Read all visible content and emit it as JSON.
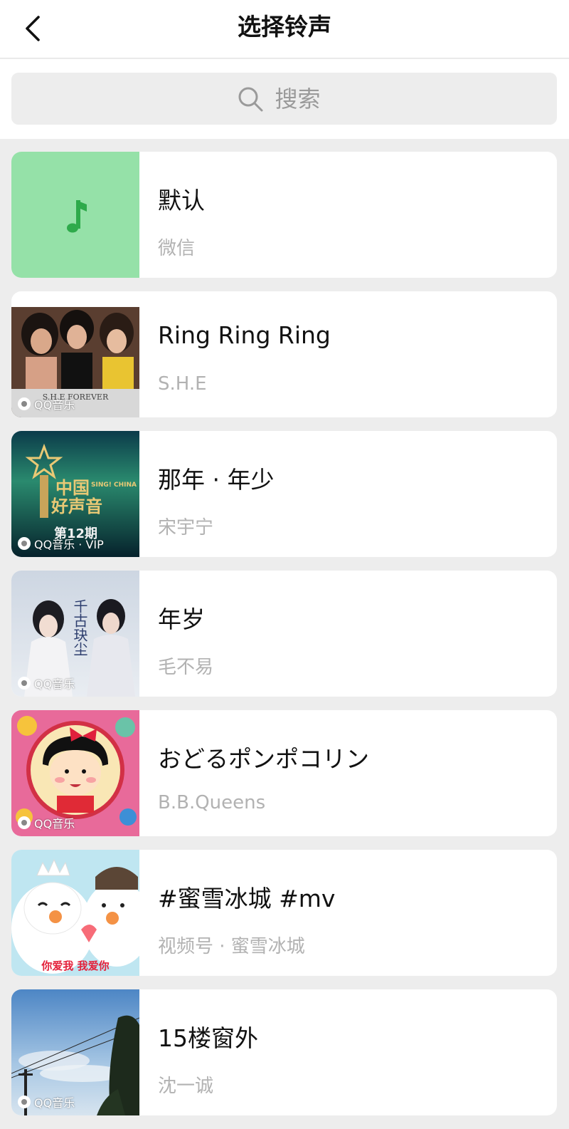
{
  "nav": {
    "title": "选择铃声",
    "back_icon": "chevron-left-icon"
  },
  "search": {
    "placeholder": "搜索",
    "icon": "search-icon"
  },
  "ringtones": [
    {
      "title": "默认",
      "subtitle": "微信",
      "cover": "default-green-note",
      "badge": ""
    },
    {
      "title": "Ring Ring Ring",
      "subtitle": "S.H.E",
      "cover": "album-she-forever",
      "badge": "QQ音乐",
      "cover_text": "S.H.E FOREVER"
    },
    {
      "title": "那年 · 年少",
      "subtitle": "宋宇宁",
      "cover": "album-sing-china",
      "badge": "QQ音乐 · VIP",
      "cover_text_1": "中国",
      "cover_text_2": "好声音",
      "cover_text_3": "SING! CHINA",
      "cover_text_4": "第12期"
    },
    {
      "title": "年岁",
      "subtitle": "毛不易",
      "cover": "album-qian-gu-jue-chen",
      "badge": "QQ音乐",
      "cover_text": "千古玦尘"
    },
    {
      "title": "おどるポンポコリン",
      "subtitle": "B.B.Queens",
      "cover": "album-chibi-maruko",
      "badge": "QQ音乐"
    },
    {
      "title": "#蜜雪冰城 #mv",
      "subtitle": "视频号 · 蜜雪冰城",
      "cover": "video-mixue-snowman",
      "badge": "",
      "cover_text": "你爱我  我爱你"
    },
    {
      "title": "15楼窗外",
      "subtitle": "沈一诚",
      "cover": "album-sky-window",
      "badge": "QQ音乐"
    }
  ],
  "colors": {
    "default_cover_bg": "#95e1a8",
    "note_green": "#2eaa4b",
    "subtitle_gray": "#b2b2b2",
    "page_bg": "#ededed"
  }
}
